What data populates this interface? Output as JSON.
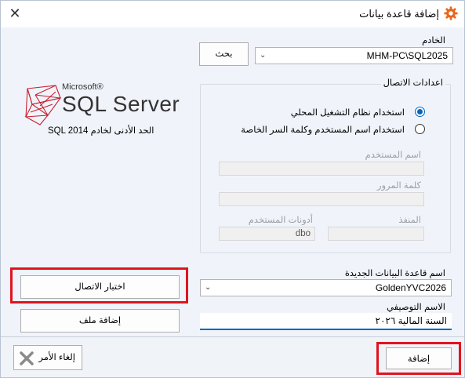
{
  "window": {
    "title": "إضافة قاعدة بيانات",
    "close_icon": "✕"
  },
  "server": {
    "label": "الخادم",
    "value": "MHM-PC\\SQL2025",
    "browse_button": "بحث"
  },
  "logo": {
    "brand": "Microsoft®",
    "product": "SQL Server",
    "min_version_note": "الحد الأدنى لخادم SQL 2014"
  },
  "connection": {
    "group_title": "اعدادات الاتصال",
    "options": [
      {
        "label": "استخدام نظام التشغيل المحلي",
        "checked": true
      },
      {
        "label": "استخدام اسم المستخدم وكلمة السر الخاصة",
        "checked": false
      }
    ],
    "username_label": "اسم المستخدم",
    "username_value": "",
    "password_label": "كلمة المرور",
    "password_value": "",
    "port_label": "المنفذ",
    "port_value": "",
    "user_tools_label": "أدونات المستخدم",
    "user_tools_value": "dbo"
  },
  "database": {
    "name_label": "اسم قاعدة البيانات الجديدة",
    "name_value": "GoldenYVC2026",
    "description_label": "الاسم التوصيفي",
    "description_value": "السنة المالية ٢٠٢٦"
  },
  "buttons": {
    "test_connection": "اختبار الاتصال",
    "add_file": "إضافة ملف",
    "cancel": "إلغاء الأمر",
    "add": "إضافة"
  },
  "colors": {
    "accent": "#0067c0",
    "highlight_border": "#e0141e",
    "cancel_icon": "#8a8a8a"
  }
}
